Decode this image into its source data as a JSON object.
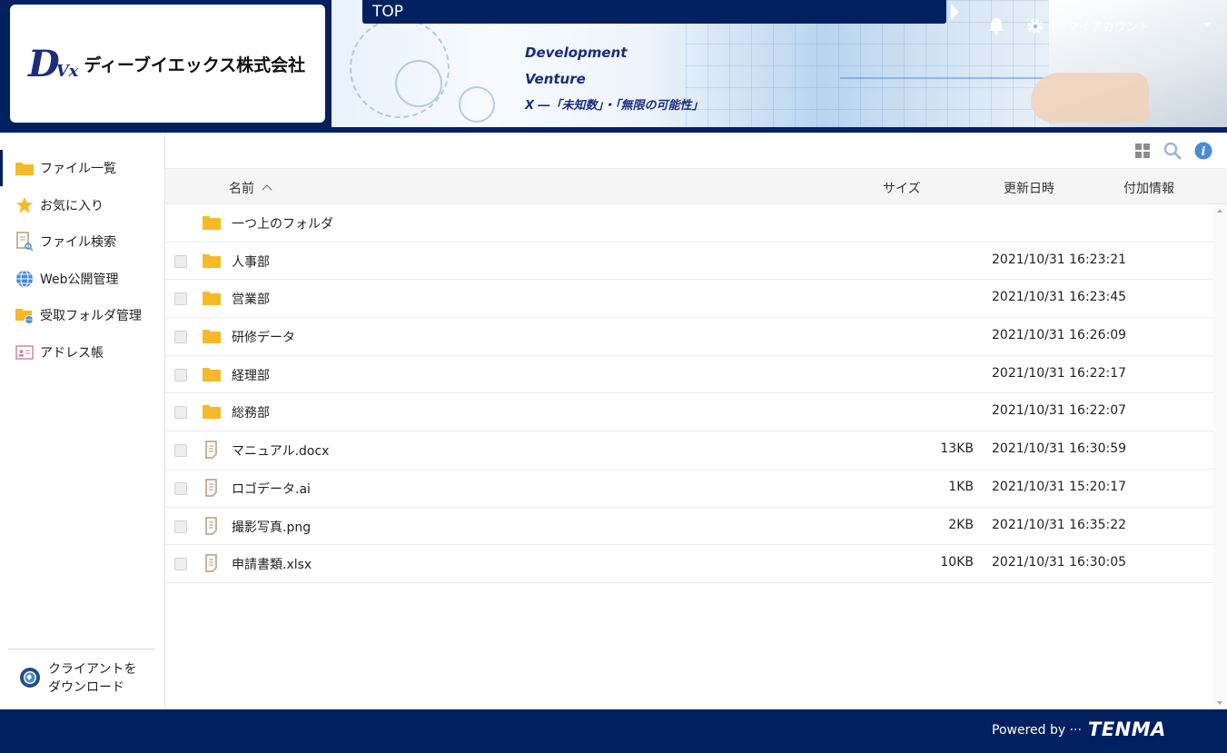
{
  "header": {
    "company_name": "ディーブイエックス株式会社",
    "logo_mark": "DVx",
    "topbar_title": "TOP",
    "account_label": "マイアカウント",
    "tagline": {
      "line1": "Development",
      "line2": "Venture",
      "line3": "X ―「未知数」・「無限の可能性」"
    }
  },
  "sidebar": {
    "items": [
      {
        "label": "ファイル一覧",
        "icon": "folder-icon",
        "active": true
      },
      {
        "label": "お気に入り",
        "icon": "star-icon",
        "active": false
      },
      {
        "label": "ファイル検索",
        "icon": "file-search-icon",
        "active": false
      },
      {
        "label": "Web公開管理",
        "icon": "globe-icon",
        "active": false
      },
      {
        "label": "受取フォルダ管理",
        "icon": "folder-globe-icon",
        "active": false
      },
      {
        "label": "アドレス帳",
        "icon": "address-card-icon",
        "active": false
      }
    ],
    "download_line1": "クライアントを",
    "download_line2": "ダウンロード"
  },
  "table": {
    "columns": {
      "name": "名前",
      "size": "サイズ",
      "modified": "更新日時",
      "info": "付加情報"
    },
    "parent_folder": "一つ上のフォルダ",
    "rows": [
      {
        "type": "folder",
        "name": "人事部",
        "size": "",
        "modified": "2021/10/31 16:23:21"
      },
      {
        "type": "folder",
        "name": "営業部",
        "size": "",
        "modified": "2021/10/31 16:23:45"
      },
      {
        "type": "folder",
        "name": "研修データ",
        "size": "",
        "modified": "2021/10/31 16:26:09"
      },
      {
        "type": "folder",
        "name": "経理部",
        "size": "",
        "modified": "2021/10/31 16:22:17"
      },
      {
        "type": "folder",
        "name": "総務部",
        "size": "",
        "modified": "2021/10/31 16:22:07"
      },
      {
        "type": "file",
        "name": "マニュアル.docx",
        "size": "13KB",
        "modified": "2021/10/31 16:30:59"
      },
      {
        "type": "file",
        "name": "ロゴデータ.ai",
        "size": "1KB",
        "modified": "2021/10/31 15:20:17"
      },
      {
        "type": "file",
        "name": "撮影写真.png",
        "size": "2KB",
        "modified": "2021/10/31 16:35:22"
      },
      {
        "type": "file",
        "name": "申請書類.xlsx",
        "size": "10KB",
        "modified": "2021/10/31 16:30:05"
      }
    ]
  },
  "footer": {
    "powered_by": "Powered by ···",
    "brand": "TENMA"
  },
  "colors": {
    "navy": "#002060",
    "folder": "#f7b928",
    "file_icon": "#b59a7a",
    "info_blue": "#4a8ad6"
  }
}
